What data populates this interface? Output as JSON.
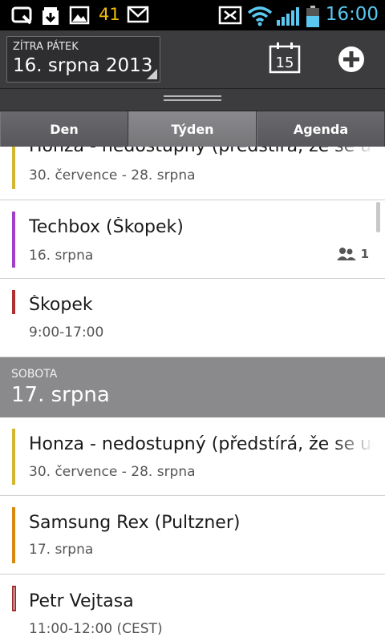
{
  "status_bar": {
    "icons": [
      "screenshot-app-icon",
      "download-icon",
      "image-icon",
      "gmail-icon",
      "nfc-icon",
      "wifi-icon",
      "signal-icon",
      "battery-icon"
    ],
    "notification_count": "41",
    "time": "16:00",
    "accent": "#5ac8f0"
  },
  "header": {
    "date_caption": "ZÍTRA PÁTEK",
    "date_value": "16. srpna 2013",
    "today_day": "15"
  },
  "tabs": [
    {
      "label": "Den",
      "active": false
    },
    {
      "label": "Týden",
      "active": true
    },
    {
      "label": "Agenda",
      "active": false
    }
  ],
  "agenda": {
    "day_header": {
      "dow": "SOBOTA",
      "date": "17. srpna"
    },
    "events_before": [
      {
        "title": "Honza - nedostupný (předstírá, že se u",
        "sub": "30. července - 28. srpna",
        "color": "#d4b630"
      },
      {
        "title": "Techbox (Škopek)",
        "sub": "16. srpna",
        "color": "#a040c8",
        "attendees": "1"
      },
      {
        "title": "Škopek",
        "sub": "9:00-17:00",
        "color": "#b03030"
      }
    ],
    "events_after": [
      {
        "title": "Honza - nedostupný (předstírá, že se uč",
        "sub": "30. července - 28. srpna",
        "color": "#d4b630"
      },
      {
        "title": "Samsung Rex (Pultzner)",
        "sub": "17. srpna",
        "color": "#d88a10"
      },
      {
        "title": "Petr Vejtasa",
        "sub": "11:00-12:00 (CEST)",
        "color": "#a03030"
      }
    ]
  }
}
